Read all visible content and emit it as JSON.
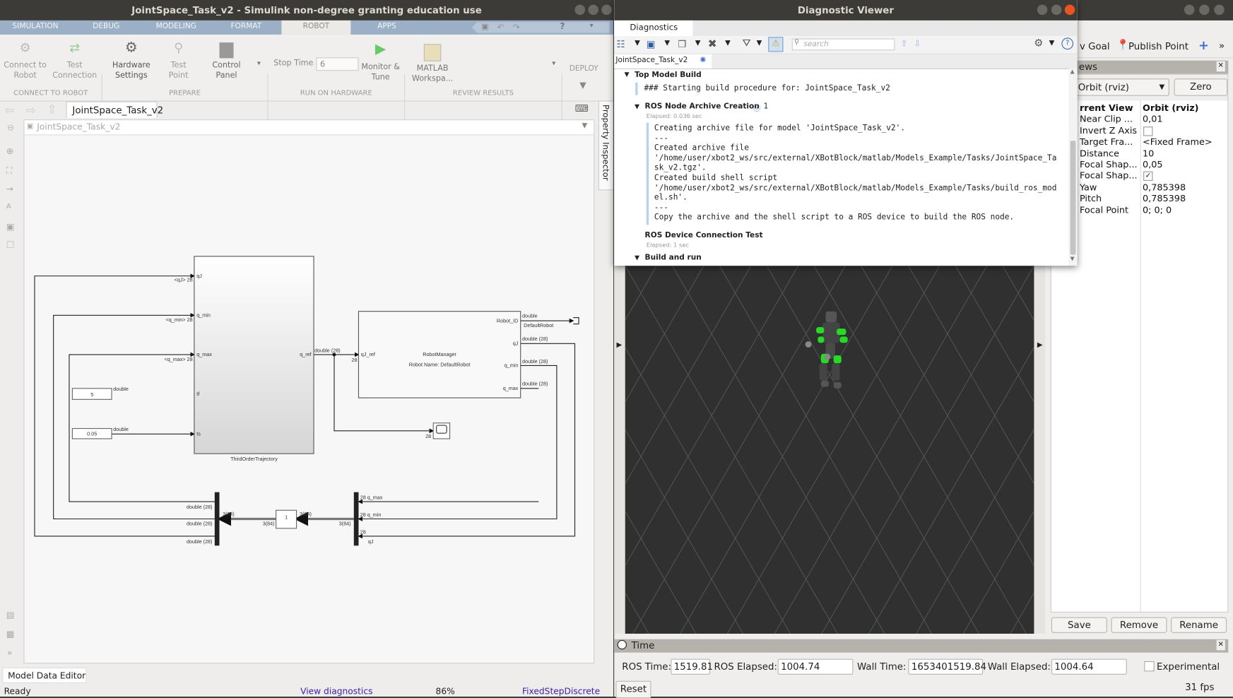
{
  "simulink": {
    "title": "JointSpace_Task_v2 - Simulink non-degree granting education use",
    "tabs": [
      "SIMULATION",
      "DEBUG",
      "MODELING",
      "FORMAT",
      "ROBOT",
      "APPS"
    ],
    "active_tab": "ROBOT",
    "toolstrip": {
      "connect_to_robot": "Connect to Robot",
      "test_connection": "Test Connection",
      "hardware_settings": "Hardware Settings",
      "test_point": "Test Point",
      "control_panel": "Control Panel",
      "stop_time_label": "Stop Time",
      "stop_time_value": "6",
      "monitor_tune": "Monitor & Tune",
      "matlab_workspace": "MATLAB Workspa...",
      "deploy": "DEPLOY",
      "groups": [
        "CONNECT TO ROBOT",
        "PREPARE",
        "RUN ON HARDWARE",
        "REVIEW RESULTS"
      ]
    },
    "model_tab": "JointSpace_Task_v2",
    "breadcrumb": "JointSpace_Task_v2",
    "property_inspector": "Property Inspector",
    "model_data_editor": "Model Data Editor",
    "status": {
      "ready": "Ready",
      "view_diagnostics": "View diagnostics",
      "zoom": "86%",
      "solver": "FixedStepDiscrete"
    },
    "diagram": {
      "trajectory_block": "ThirdOrderTrajectory",
      "traj_ports": [
        "qJ",
        "q_min",
        "q_max",
        "tf",
        "ts",
        "q_ref"
      ],
      "in_labels": [
        "<qJ> 28",
        "<q_min> 28",
        "<q_max> 28"
      ],
      "const1": "5",
      "const2": "0.05",
      "double": "double",
      "sig_qref": "double (28)",
      "dim28": "28",
      "robot_block": "RobotManager",
      "robot_name": "Robot Name: DefaultRobot",
      "robot_in": "qJ_ref",
      "robot_out": [
        "Robot_ID",
        "qJ",
        "q_min",
        "q_max"
      ],
      "robot_out_types": [
        "double",
        "double (28)",
        "double (28)",
        "double (28)"
      ],
      "default_robot": "DefaultRobot",
      "bus_left_labels": [
        "double (28)",
        "double (28)",
        "double (28)"
      ],
      "bus_right_labels": [
        "28 q_max",
        "28 q_min",
        "28",
        "qJ"
      ],
      "bus_dims": [
        "3(84)",
        "3(84)",
        "3(84)",
        "3(84)"
      ],
      "gain": "1"
    }
  },
  "diagnostic_viewer": {
    "title": "Diagnostic Viewer",
    "tab": "Diagnostics",
    "search_placeholder": "search",
    "model_tab": "JointSpace_Task_v2",
    "sections": {
      "top_build": "Top Model Build",
      "top_msg": "### Starting build procedure for: JointSpace_Task_v2",
      "archive": "ROS Node Archive Creation",
      "archive_info_count": "1",
      "archive_elapsed": "Elapsed: 0.036 sec",
      "archive_lines": [
        "Creating archive file for model 'JointSpace_Task_v2'.",
        "---",
        "Created archive file",
        "'/home/user/xbot2_ws/src/external/XBotBlock/matlab/Models_Example/Tasks/JointSpace_Ta",
        "sk_v2.tgz'.",
        "Created build shell script",
        "'/home/user/xbot2_ws/src/external/XBotBlock/matlab/Models_Example/Tasks/build_ros_mod",
        "el.sh'.",
        "---",
        "Copy the archive and the shell script to a ROS device to build the ROS node."
      ],
      "conn_test": "ROS Device Connection Test",
      "conn_elapsed": "Elapsed: 1 sec",
      "build_run": "Build and run"
    }
  },
  "rviz": {
    "toolbar": {
      "nav_goal": "v Goal",
      "publish_point": "Publish Point",
      "more": "»"
    },
    "views_title": "ews",
    "view_type": "Orbit (rviz)",
    "zero": "Zero",
    "properties": [
      {
        "name": "rrent View",
        "value": "Orbit (rviz)"
      },
      {
        "name": "Near Clip ...",
        "value": "0,01"
      },
      {
        "name": "Invert Z Axis",
        "checkbox": false
      },
      {
        "name": "Target Fra...",
        "value": "<Fixed Frame>"
      },
      {
        "name": "Distance",
        "value": "10"
      },
      {
        "name": "Focal Shap...",
        "value": "0,05"
      },
      {
        "name": "Focal Shap...",
        "checkbox": true
      },
      {
        "name": "Yaw",
        "value": "0,785398"
      },
      {
        "name": "Pitch",
        "value": "0,785398"
      },
      {
        "name": "Focal Point",
        "value": "0; 0; 0"
      }
    ],
    "buttons": {
      "save": "Save",
      "remove": "Remove",
      "rename": "Rename"
    },
    "robot_color": "#22dd22"
  },
  "time_panel": {
    "title": "Time",
    "ros_time_label": "ROS Time:",
    "ros_time": "1519.81",
    "ros_elapsed_label": "ROS Elapsed:",
    "ros_elapsed": "1004.74",
    "wall_time_label": "Wall Time:",
    "wall_time": "1653401519.84",
    "wall_elapsed_label": "Wall Elapsed:",
    "wall_elapsed": "1004.64",
    "experimental": "Experimental",
    "experimental_checked": false,
    "reset": "Reset",
    "fps": "31 fps"
  }
}
